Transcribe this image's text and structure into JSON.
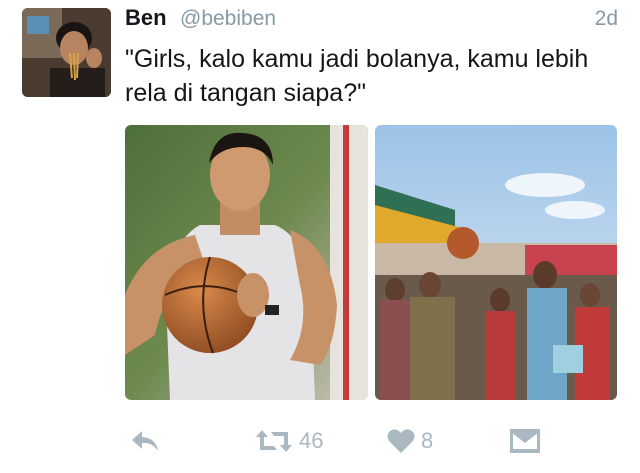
{
  "tweet": {
    "name": "Ben",
    "handle": "@bebiben",
    "time": "2d",
    "text": "\"Girls, kalo kamu jadi bolanya, kamu lebih rela di tangan siapa?\""
  },
  "actions": {
    "retweets": "46",
    "likes": "8"
  },
  "icons": {
    "reply": "reply-icon",
    "retweet": "retweet-icon",
    "like": "heart-icon",
    "dm": "envelope-icon"
  },
  "colors": {
    "text": "#14171a",
    "muted": "#8899a6",
    "action": "#aab8c2"
  }
}
